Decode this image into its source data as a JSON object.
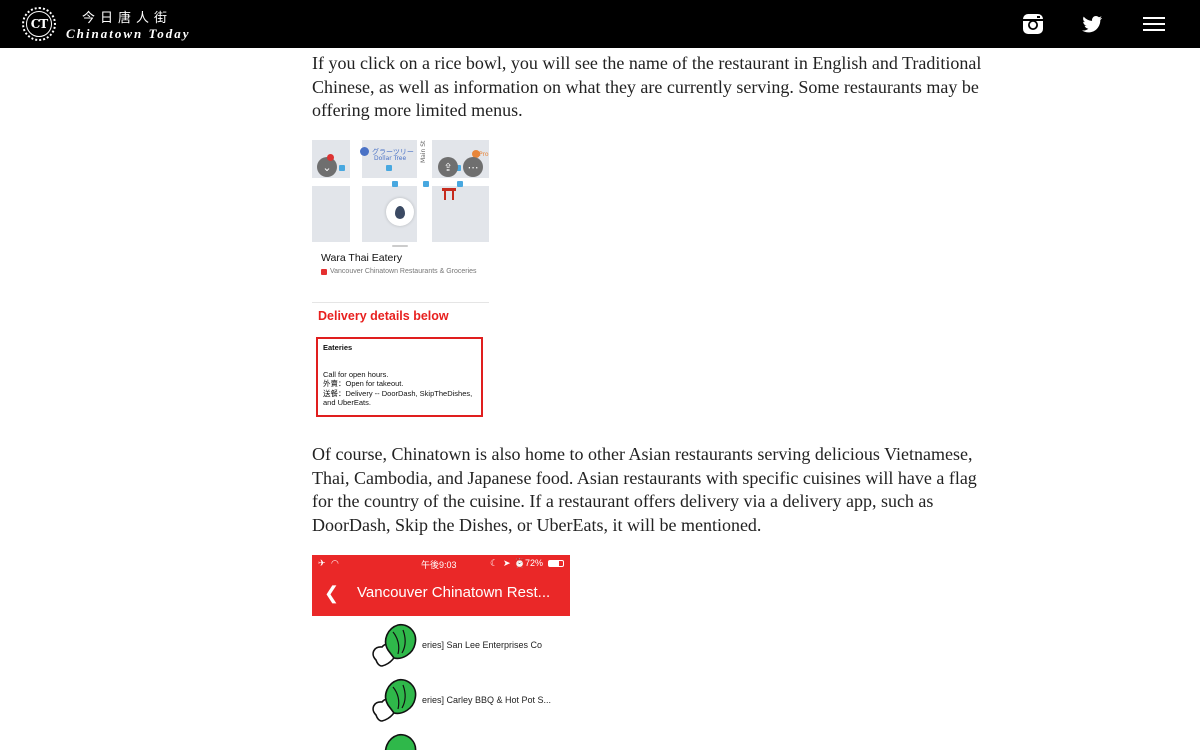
{
  "header": {
    "logo_mark": "CT",
    "title_cn": "今日唐人街",
    "title_en": "Chinatown Today",
    "icons": [
      "instagram-icon",
      "twitter-icon",
      "menu-icon"
    ]
  },
  "article": {
    "para1": "If you click on a rice bowl, you will see the name of the restaurant in English and Traditional Chinese, as well as information on what they are currently serving. Some restaurants may be offering more limited menus.",
    "para2": "Of course, Chinatown is also home to other Asian restaurants serving delicious Vietnamese, Thai, Cambodia, and Japanese food. Asian restaurants with specific cuisines will have a flag for the country of the cuisine. If a restaurant offers delivery via a delivery app, such as DoorDash, Skip the Dishes, or UberEats, it will be mentioned."
  },
  "screenshot1": {
    "map_label_jp": "グラーツリー",
    "map_label_en": "Dollar Tree",
    "street": "Main St",
    "poi_partial": "Pro",
    "place_name": "Wara Thai Eatery",
    "place_category": "Vancouver Chinatown Restaurants & Groceries",
    "delivery_heading": "Delivery details below",
    "box_heading": "Eateries",
    "box_line1": "Call for open hours.",
    "box_line2": "外賣：Open for takeout.",
    "box_line3": "送餐：Delivery -- DoorDash, SkipTheDishes, and UberEats."
  },
  "screenshot2": {
    "time": "午後9:03",
    "battery": "72%",
    "title": "Vancouver Chinatown Rest...",
    "rows": [
      {
        "text": "eries] San Lee Enterprises Co"
      },
      {
        "text": "eries] Carley BBQ & Hot Pot S..."
      }
    ]
  },
  "colors": {
    "header_bg": "#000000",
    "accent_red": "#ea2828"
  }
}
